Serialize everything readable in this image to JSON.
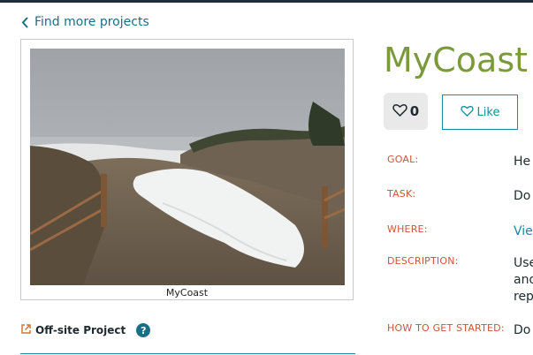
{
  "nav": {
    "back_label": "Find more projects"
  },
  "project": {
    "title": "MyCoast",
    "image_caption": "MyCoast",
    "offsite_label": "Off-site Project",
    "help_symbol": "?",
    "favorites_count": "0",
    "like_label": "Like"
  },
  "details": {
    "goal_label": "GOAL:",
    "goal_value": "He",
    "task_label": "TASK:",
    "task_value": "Do",
    "where_label": "WHERE:",
    "where_value": "Vie",
    "description_label": "DESCRIPTION:",
    "description_lines": [
      "Use",
      "and",
      "rep"
    ],
    "start_label": "HOW TO GET STARTED:",
    "start_value": "Do"
  },
  "colors": {
    "title": "#7a9a3c",
    "accent": "#1a8aa0",
    "label": "#c8553d"
  },
  "icons": {
    "back": "chevron-left-icon",
    "external": "external-link-icon",
    "heart": "heart-icon"
  }
}
